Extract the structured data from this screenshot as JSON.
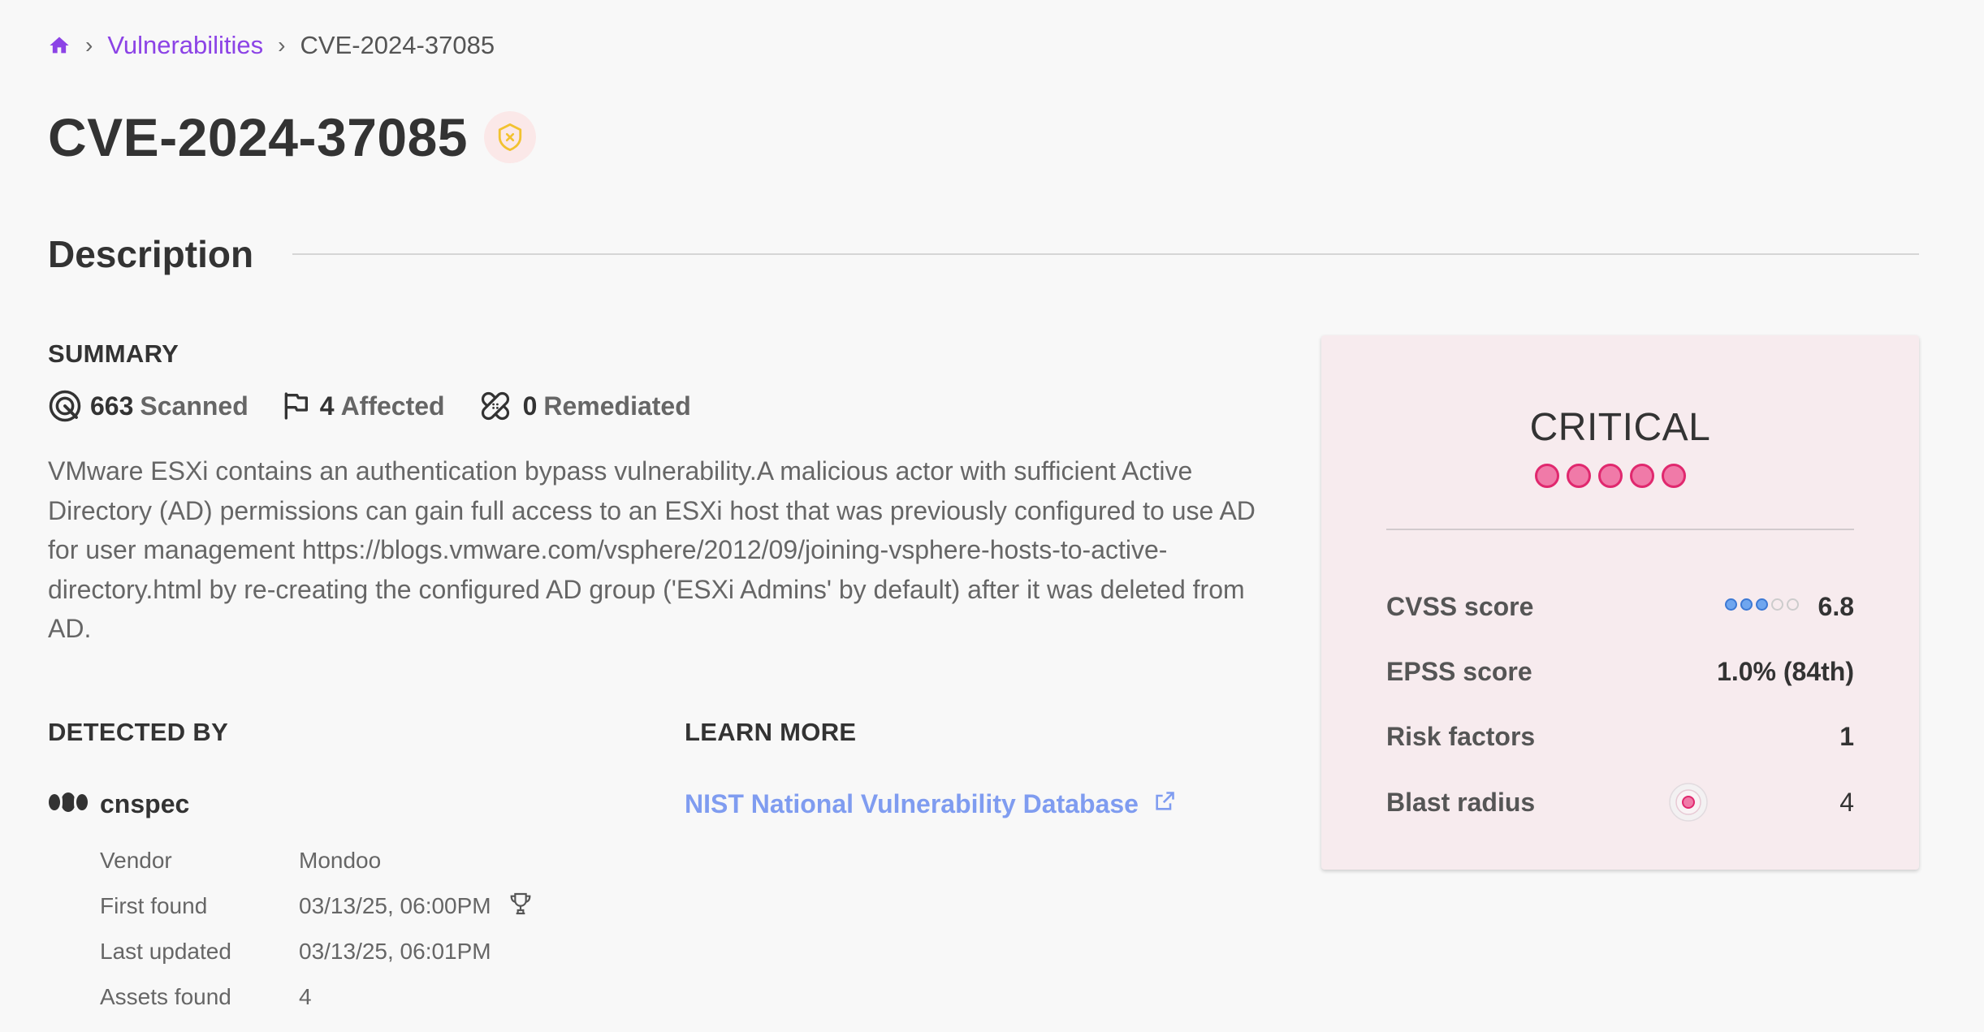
{
  "breadcrumb": {
    "home_icon": "home-icon",
    "items": [
      "Vulnerabilities",
      "CVE-2024-37085"
    ]
  },
  "page": {
    "title": "CVE-2024-37085",
    "badge_icon": "shield-x-icon"
  },
  "description": {
    "heading": "Description",
    "summary_label": "SUMMARY",
    "stats": {
      "scanned": {
        "value": "663",
        "label": "Scanned",
        "icon": "target-icon"
      },
      "affected": {
        "value": "4",
        "label": "Affected",
        "icon": "flag-icon"
      },
      "remediated": {
        "value": "0",
        "label": "Remediated",
        "icon": "bandage-icon"
      }
    },
    "text": "VMware ESXi contains an authentication bypass vulnerability.A malicious actor with sufficient Active Directory (AD) permissions can gain full access to an ESXi host that was previously configured to use AD for user management https://blogs.vmware.com/vsphere/2012/09/joining-vsphere-hosts-to-active-directory.html by re-creating the configured AD group ('ESXi Admins' by default) after it was deleted from AD."
  },
  "detected_by": {
    "label": "DETECTED BY",
    "tool_name": "cnspec",
    "tool_icon": "mondoo-logo-icon",
    "details": [
      {
        "key": "Vendor",
        "value": "Mondoo"
      },
      {
        "key": "First found",
        "value": "03/13/25, 06:00PM"
      },
      {
        "key": "Last updated",
        "value": "03/13/25, 06:01PM"
      },
      {
        "key": "Assets found",
        "value": "4"
      }
    ]
  },
  "learn_more": {
    "label": "LEARN MORE",
    "link_text": "NIST National Vulnerability Database",
    "link_icon": "external-link-icon"
  },
  "risk_card": {
    "severity": "CRITICAL",
    "severity_level": 5,
    "severity_max": 5,
    "metrics": {
      "cvss": {
        "label": "CVSS score",
        "value": "6.8",
        "dots_filled": 3,
        "dots_total": 5
      },
      "epss": {
        "label": "EPSS score",
        "value": "1.0% (84th)"
      },
      "risk_factors": {
        "label": "Risk factors",
        "value": "1"
      },
      "blast_radius": {
        "label": "Blast radius",
        "value": "4",
        "icon": "blast-radius-icon"
      }
    }
  },
  "colors": {
    "accent": "#8c43e6",
    "link": "#7f9cf0",
    "critical": "#e0286e",
    "card_bg": "#f7ebee"
  }
}
